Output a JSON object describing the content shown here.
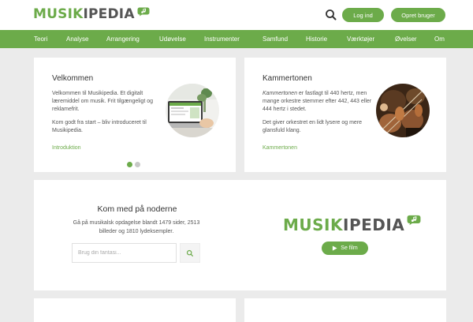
{
  "header": {
    "logo": {
      "part1": "M",
      "part2": "USIK",
      "part3": "IPEDIA",
      "icon": "music-note-speech-bubble-icon"
    },
    "search_icon": "search-icon",
    "login_label": "Log ind",
    "register_label": "Opret bruger"
  },
  "nav": {
    "items": [
      "Teori",
      "Analyse",
      "Arrangering",
      "Udøvelse",
      "Instrumenter",
      "Samfund",
      "Historie",
      "Værktøjer",
      "Øvelser",
      "Om"
    ]
  },
  "cards": [
    {
      "title": "Velkommen",
      "paragraph1": "Velkommen til Musikipedia. Et digitalt læremiddel om musik. Frit tilgængeligt og reklamefrit.",
      "paragraph2": "Kom godt fra start – bliv introduceret til Musikipedia.",
      "link": "Introduktion",
      "image": "laptop-on-desk-photo"
    },
    {
      "title": "Kammertonen",
      "paragraph1_em": "Kammertonen",
      "paragraph1_rest": " er fastlagt til 440 hertz, men mange orkestre stemmer efter 442, 443 eller 444 hertz i stedet.",
      "paragraph2": "Det giver orkestret en lidt lysere og mere glansfuld klang.",
      "link": "Kammertonen",
      "image": "orchestra-violins-photo"
    }
  ],
  "carousel": {
    "active_index": 0,
    "count": 2
  },
  "cta": {
    "title": "Kom med på noderne",
    "description": "Gå på musikalsk opdagelse blandt 1479 sider, 2513 billeder og 1810 lydeksempler.",
    "search_placeholder": "Brug din fantasi...",
    "search_value": "",
    "play_label": "Se film",
    "play_icon": "play-icon"
  },
  "colors": {
    "brand_green": "#6cab4a",
    "background": "#ebebeb",
    "text_dark": "#333333"
  }
}
